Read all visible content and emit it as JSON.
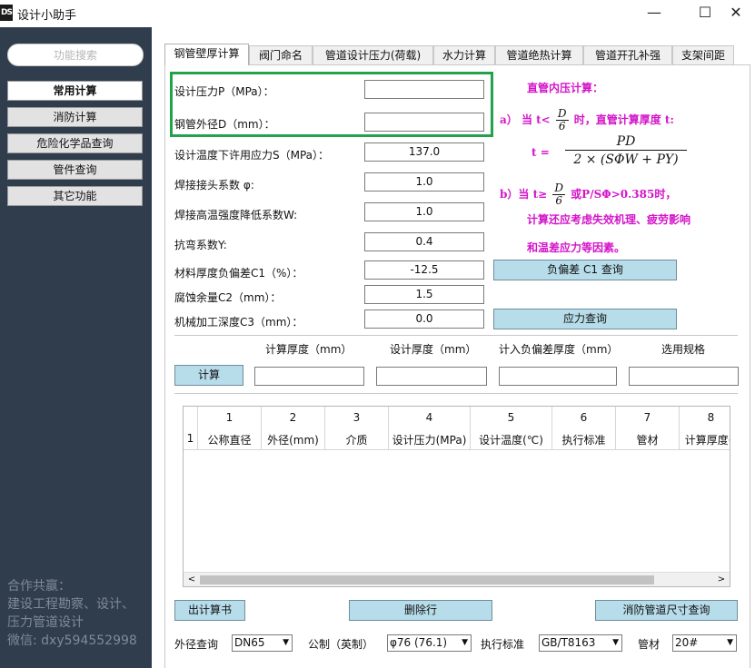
{
  "window": {
    "icon_text": "DS",
    "title": "设计小助手",
    "minimize": "—",
    "maximize": "☐",
    "close": "✕"
  },
  "sidebar": {
    "search_placeholder": "功能搜索",
    "items": [
      "常用计算",
      "消防计算",
      "危险化学品查询",
      "管件查询",
      "其它功能"
    ],
    "active_index": 0,
    "footer": [
      "合作共赢：",
      "建设工程勘察、设计、",
      "压力管道设计",
      "微信: dxy594552998"
    ]
  },
  "tabs": [
    "钢管壁厚计算",
    "阀门命名",
    "管道设计压力(荷载)",
    "水力计算",
    "管道绝热计算",
    "管道开孔补强",
    "支架间距"
  ],
  "active_tab": 0,
  "form": {
    "rows": [
      {
        "label": "设计压力P（MPa）：",
        "value": ""
      },
      {
        "label": "钢管外径D（mm）：",
        "value": ""
      },
      {
        "label": "设计温度下许用应力S（MPa）：",
        "value": "137.0"
      },
      {
        "label": "焊接接头系数 φ:",
        "value": "1.0"
      },
      {
        "label": "焊接高温强度降低系数W:",
        "value": "1.0"
      },
      {
        "label": "抗弯系数Y:",
        "value": "0.4"
      },
      {
        "label": "材料厚度负偏差C1（%）：",
        "value": "-12.5"
      },
      {
        "label": "腐蚀余量C2（mm）：",
        "value": "1.5"
      },
      {
        "label": "机械加工深度C3（mm）：",
        "value": "0.0"
      }
    ],
    "c1_button": "负偏差 C1 查询",
    "stress_button": "应力查询"
  },
  "formula": {
    "title": "直管内压计算：",
    "a_prefix": "a）  当 t<",
    "a_frac_num": "D",
    "a_frac_den": "6",
    "a_suffix": "时，直管计算厚度 t:",
    "t_eq": "t  =",
    "main_num": "PD",
    "main_den": "2 × (SΦW + PY)",
    "b_prefix": "b）当 t≥",
    "b_frac_num": "D",
    "b_frac_den": "6",
    "b_suffix": "或P/SΦ>0.385时，",
    "line3": "计算还应考虑失效机理、疲劳影响",
    "line4": "和温差应力等因素。"
  },
  "results": {
    "calc_button": "计算",
    "headers": [
      "计算厚度（mm）",
      "设计厚度（mm）",
      "计入负偏差厚度（mm）",
      "选用规格"
    ],
    "values": [
      "",
      "",
      "",
      ""
    ]
  },
  "grid": {
    "row_header": "1",
    "columns": [
      {
        "num": "1",
        "name": "公称直径"
      },
      {
        "num": "2",
        "name": "外径(mm)"
      },
      {
        "num": "3",
        "name": "介质"
      },
      {
        "num": "4",
        "name": "设计压力(MPa)"
      },
      {
        "num": "5",
        "name": "设计温度(℃)"
      },
      {
        "num": "6",
        "name": "执行标准"
      },
      {
        "num": "7",
        "name": "管材"
      },
      {
        "num": "8",
        "name": "计算厚度(r"
      }
    ],
    "scroll_left": "<",
    "scroll_right": ">"
  },
  "actions": {
    "report_button": "出计算书",
    "delete_button": "删除行",
    "fire_button": "消防管道尺寸查询"
  },
  "bottom": {
    "od_label": "外径查询",
    "od_value": "DN65",
    "metric_label": "公制（英制）",
    "metric_value": "φ76 (76.1)",
    "std_label": "执行标准",
    "std_value": "GB/T8163",
    "mat_label": "管材",
    "mat_value": "20#",
    "arrow": "▼"
  }
}
